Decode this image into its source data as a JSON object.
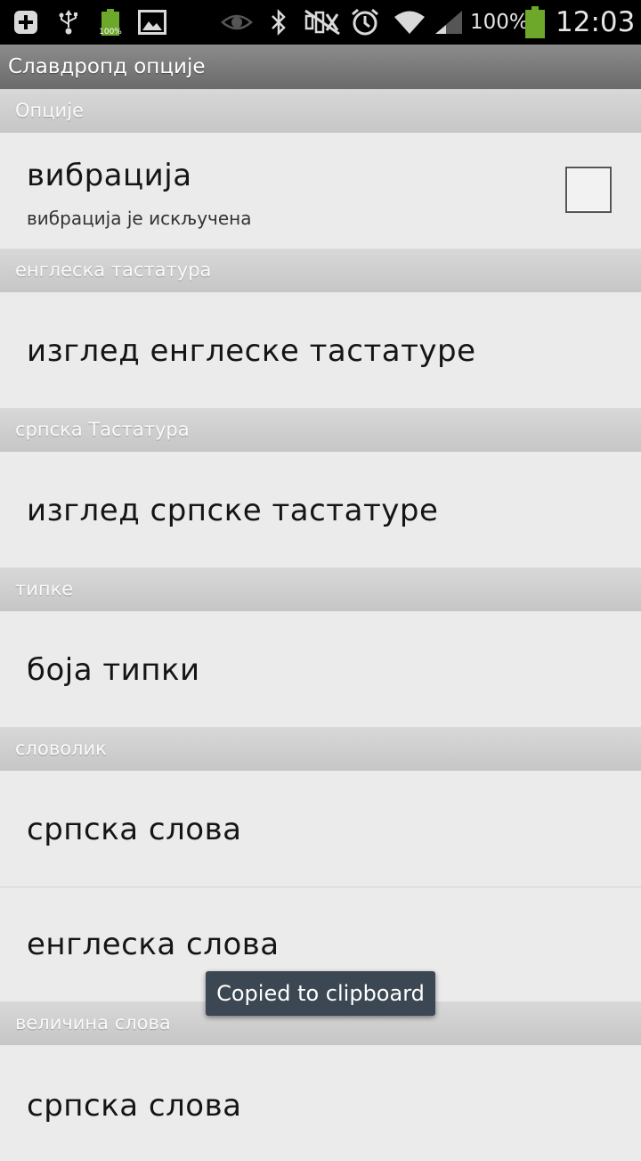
{
  "status_bar": {
    "battery_percent": "100%",
    "battery_small_label": "100%",
    "time": "12:03",
    "icons": [
      "add-icon",
      "usb-icon",
      "battery-charging-icon",
      "image-icon",
      "eye-icon",
      "bluetooth-icon",
      "mute-icon",
      "alarm-icon",
      "wifi-icon",
      "signal-icon",
      "battery-icon"
    ],
    "battery_color": "#6ea82a"
  },
  "title_bar": {
    "title": "Славдропд опције"
  },
  "sections": [
    {
      "header": "Опције",
      "items": [
        {
          "label": "вибрација",
          "summary": "вибрација је искључена",
          "checked": false
        }
      ]
    },
    {
      "header": "енглеска тастатура",
      "items": [
        {
          "label": "изглед енглеске тастатуре"
        }
      ]
    },
    {
      "header": "српска Тастатура",
      "items": [
        {
          "label": "изглед српске тастатуре"
        }
      ]
    },
    {
      "header": "типке",
      "items": [
        {
          "label": "боја типки"
        }
      ]
    },
    {
      "header": "словолик",
      "items": [
        {
          "label": "српска слова"
        },
        {
          "label": "енглеска слова"
        }
      ]
    },
    {
      "header": "величина слова",
      "items": [
        {
          "label": "српска слова"
        }
      ]
    }
  ],
  "toast": {
    "text": "Copied to clipboard"
  }
}
